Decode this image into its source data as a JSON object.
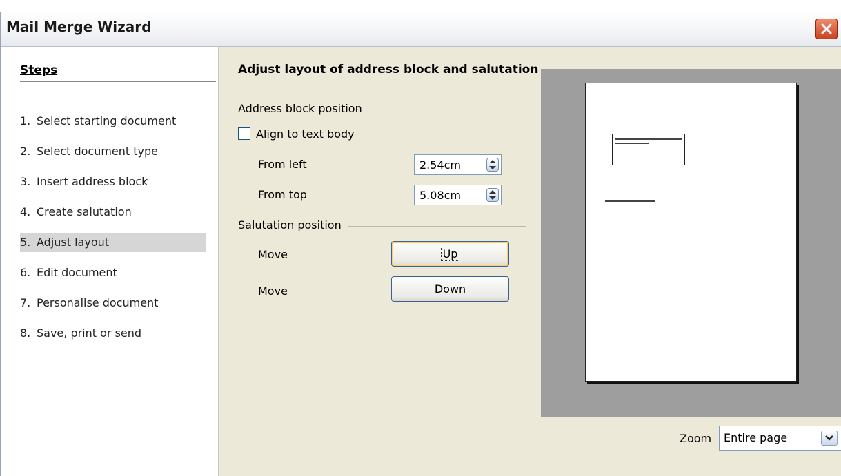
{
  "window": {
    "title": "Mail Merge Wizard"
  },
  "steps": {
    "header": "Steps",
    "items": [
      {
        "num": "1.",
        "label": "Select starting document"
      },
      {
        "num": "2.",
        "label": "Select document type"
      },
      {
        "num": "3.",
        "label": "Insert address block"
      },
      {
        "num": "4.",
        "label": "Create salutation"
      },
      {
        "num": "5.",
        "label": "Adjust layout"
      },
      {
        "num": "6.",
        "label": "Edit document"
      },
      {
        "num": "7.",
        "label": "Personalise document"
      },
      {
        "num": "8.",
        "label": "Save, print or send"
      }
    ],
    "active_index": 4
  },
  "main": {
    "title": "Adjust layout of address block and salutation",
    "address_group": {
      "label": "Address block position",
      "align_checkbox_label": "Align to text body",
      "align_checked": false,
      "from_left_label": "From left",
      "from_left_value": "2.54cm",
      "from_top_label": "From top",
      "from_top_value": "5.08cm"
    },
    "salutation_group": {
      "label": "Salutation position",
      "move_label_1": "Move",
      "up_button": "Up",
      "move_label_2": "Move",
      "down_button": "Down"
    },
    "zoom": {
      "label": "Zoom",
      "value": "Entire page"
    }
  },
  "colors": {
    "dialog_bg": "#ece9d8",
    "preview_bg": "#9e9e9e",
    "active_step_bg": "#d6d6d6",
    "close_button": "#d9532d"
  }
}
